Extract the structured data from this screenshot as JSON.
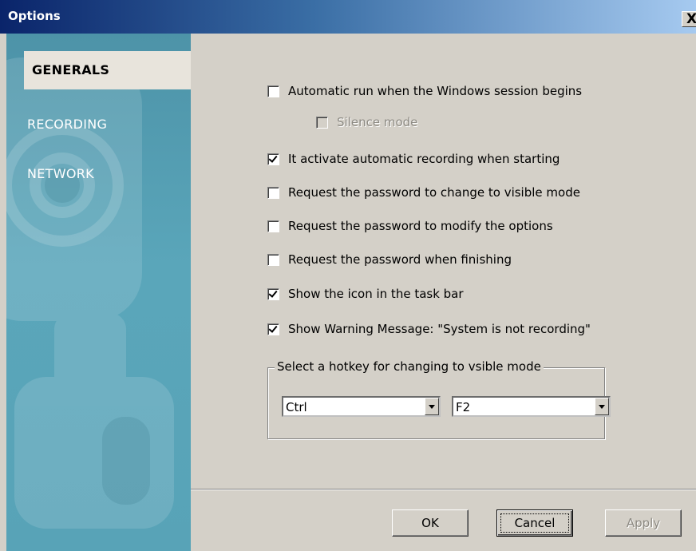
{
  "window": {
    "title": "Options",
    "close_label": "X"
  },
  "sidebar": {
    "items": [
      {
        "label": "GENERALS",
        "active": true
      },
      {
        "label": "RECORDING",
        "active": false
      },
      {
        "label": "NETWORK",
        "active": false
      }
    ]
  },
  "options": [
    {
      "label": "Automatic run when the Windows session begins",
      "checked": false,
      "enabled": true
    },
    {
      "label": "Silence mode",
      "checked": false,
      "enabled": false
    },
    {
      "label": "It activate automatic recording when starting",
      "checked": true,
      "enabled": true
    },
    {
      "label": "Request the password to change to visible mode",
      "checked": false,
      "enabled": true
    },
    {
      "label": "Request the password to modify the options",
      "checked": false,
      "enabled": true
    },
    {
      "label": "Request the password when finishing",
      "checked": false,
      "enabled": true
    },
    {
      "label": "Show the icon in the task bar",
      "checked": true,
      "enabled": true
    },
    {
      "label": "Show Warning Message: \"System is not recording\"",
      "checked": true,
      "enabled": true
    }
  ],
  "hotkey": {
    "group_label": "Select a hotkey for changing to vsible mode",
    "modifier": "Ctrl",
    "key": "F2"
  },
  "buttons": {
    "ok": "OK",
    "cancel": "Cancel",
    "apply": "Apply"
  },
  "colors": {
    "titlebar_start": "#0a246a",
    "titlebar_end": "#a6caf0",
    "sidebar": "#58a3b7",
    "dialog": "#d4d0c8"
  }
}
